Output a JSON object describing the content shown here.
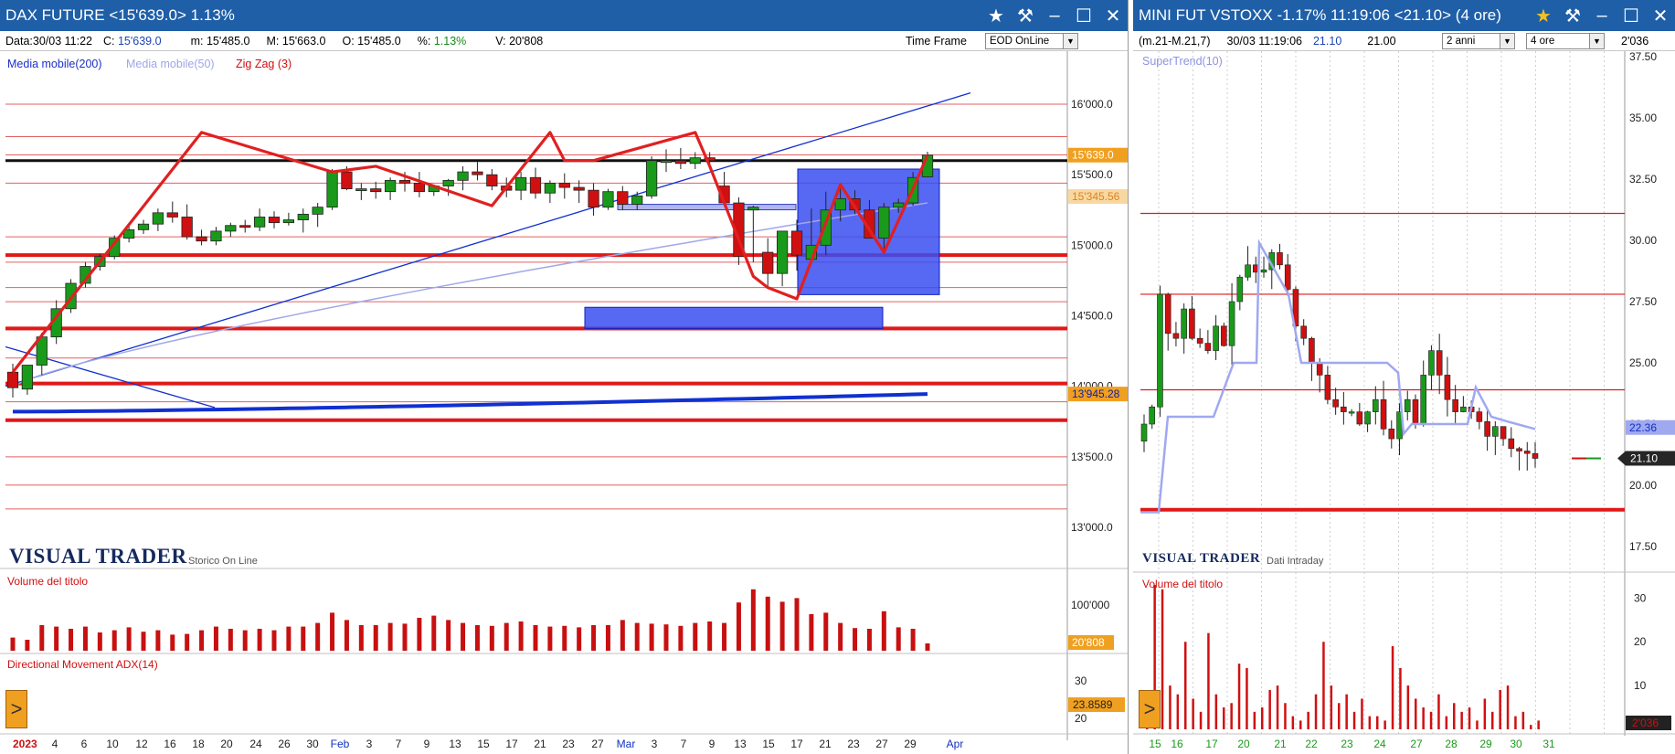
{
  "left": {
    "title": "DAX FUTURE <15'639.0> 1.13%",
    "info": {
      "data_label": "Data:",
      "data_value": "30/03 11:22",
      "close_label": "C:",
      "close_value": "15'639.0",
      "min_label": "m:",
      "min_value": "15'485.0",
      "max_label": "M:",
      "max_value": "15'663.0",
      "open_label": "O:",
      "open_value": "15'485.0",
      "pct_label": "%:",
      "pct_value": "1.13%",
      "vol_label": "V:",
      "vol_value": "20'808",
      "timeframe_label": "Time Frame",
      "timeframe_value": "EOD OnLine"
    },
    "legend": {
      "ma200": "Media mobile(200)",
      "ma50": "Media mobile(50)",
      "zigzag": "Zig Zag (3)"
    },
    "price_labels": [
      "16'000.0",
      "15'500.0",
      "15'000.0",
      "14'500.0",
      "14'000.0",
      "13'500.0",
      "13'000.0"
    ],
    "price_boxes": {
      "last": "15'639.0",
      "level": "15'345.56",
      "ma": "13'945.28"
    },
    "brand": "VISUAL TRADER",
    "brand_sub": "Storico On Line",
    "volume_title": "Volume del titolo",
    "volume_axis_label": "100'000",
    "volume_box": "20'808",
    "adx_title": "Directional Movement ADX(14)",
    "adx_labels": [
      "30",
      "20"
    ],
    "adx_box": "23.8589",
    "x_labels": [
      "2023",
      "4",
      "6",
      "10",
      "12",
      "16",
      "18",
      "20",
      "24",
      "26",
      "30",
      "Feb",
      "3",
      "7",
      "9",
      "13",
      "15",
      "17",
      "21",
      "23",
      "27",
      "Mar",
      "3",
      "7",
      "9",
      "13",
      "15",
      "17",
      "21",
      "23",
      "27",
      "29",
      "Apr"
    ],
    "colors": {
      "up": "#1a9a1a",
      "down": "#d01010",
      "ma200": "#1030d0",
      "ma50": "#a0a8e8",
      "zigzag": "#e02020",
      "box": "#3a4ef0"
    }
  },
  "right": {
    "title": "MINI FUT VSTOXX -1.17% 11:19:06 <21.10> (4 ore)",
    "info": {
      "range": "(m.21-M.21,7)",
      "datetime": "30/03 11:19:06",
      "v1": "21.10",
      "v2": "21.00",
      "period": "2 anni",
      "interval": "4 ore",
      "code": "2'036"
    },
    "legend": "SuperTrend(10)",
    "price_labels": [
      "37.50",
      "35.00",
      "32.50",
      "30.00",
      "27.50",
      "25.00",
      "22.50",
      "20.00",
      "17.50"
    ],
    "price_boxes": {
      "st": "22.36",
      "last": "21.10"
    },
    "brand": "VISUAL TRADER",
    "brand_sub": "Dati Intraday",
    "volume_title": "Volume del titolo",
    "volume_labels": [
      "30",
      "20",
      "10"
    ],
    "volume_box": "2'036",
    "x_labels": [
      "15",
      "16",
      "17",
      "20",
      "21",
      "22",
      "23",
      "24",
      "27",
      "28",
      "29",
      "30",
      "31"
    ]
  },
  "chart_data": [
    {
      "type": "candlestick",
      "title": "DAX FUTURE",
      "ylim": [
        12950,
        16150
      ],
      "x": [
        "2023-01-02",
        "2023-01-03",
        "2023-01-04",
        "2023-01-05",
        "2023-01-06",
        "2023-01-09",
        "2023-01-10",
        "2023-01-11",
        "2023-01-12",
        "2023-01-13",
        "2023-01-16",
        "2023-01-17",
        "2023-01-18",
        "2023-01-19",
        "2023-01-20",
        "2023-01-23",
        "2023-01-24",
        "2023-01-25",
        "2023-01-26",
        "2023-01-27",
        "2023-01-30",
        "2023-01-31",
        "2023-02-01",
        "2023-02-02",
        "2023-02-03",
        "2023-02-06",
        "2023-02-07",
        "2023-02-08",
        "2023-02-09",
        "2023-02-10",
        "2023-02-13",
        "2023-02-14",
        "2023-02-15",
        "2023-02-16",
        "2023-02-17",
        "2023-02-20",
        "2023-02-21",
        "2023-02-22",
        "2023-02-23",
        "2023-02-24",
        "2023-02-27",
        "2023-02-28",
        "2023-03-01",
        "2023-03-02",
        "2023-03-03",
        "2023-03-06",
        "2023-03-07",
        "2023-03-08",
        "2023-03-09",
        "2023-03-10",
        "2023-03-13",
        "2023-03-14",
        "2023-03-15",
        "2023-03-16",
        "2023-03-17",
        "2023-03-20",
        "2023-03-21",
        "2023-03-22",
        "2023-03-23",
        "2023-03-24",
        "2023-03-27",
        "2023-03-28",
        "2023-03-29",
        "2023-03-30"
      ],
      "open": [
        14100,
        13980,
        14150,
        14350,
        14550,
        14730,
        14850,
        14920,
        15050,
        15110,
        15150,
        15230,
        15200,
        15060,
        15030,
        15100,
        15140,
        15130,
        15200,
        15160,
        15180,
        15220,
        15270,
        15520,
        15400,
        15400,
        15380,
        15460,
        15440,
        15380,
        15420,
        15460,
        15520,
        15500,
        15420,
        15390,
        15480,
        15370,
        15440,
        15410,
        15390,
        15270,
        15380,
        15290,
        15350,
        15600,
        15600,
        15580,
        15620,
        15420,
        15300,
        15250,
        14950,
        14800,
        15100,
        14900,
        15000,
        15250,
        15330,
        15250,
        15050,
        15270,
        15300,
        15485
      ],
      "high": [
        14160,
        14100,
        14380,
        14610,
        14760,
        14880,
        14940,
        15070,
        15140,
        15180,
        15260,
        15310,
        15290,
        15110,
        15130,
        15160,
        15180,
        15260,
        15240,
        15230,
        15260,
        15300,
        15540,
        15560,
        15440,
        15450,
        15480,
        15520,
        15520,
        15430,
        15470,
        15560,
        15590,
        15540,
        15480,
        15520,
        15550,
        15460,
        15510,
        15460,
        15440,
        15400,
        15420,
        15380,
        15630,
        15680,
        15690,
        15660,
        15660,
        15520,
        15340,
        15280,
        15050,
        15100,
        15180,
        15260,
        15380,
        15410,
        15390,
        15320,
        15300,
        15330,
        15520,
        15663
      ],
      "low": [
        13920,
        13940,
        14080,
        14300,
        14520,
        14700,
        14820,
        14900,
        15020,
        15080,
        15100,
        15160,
        15040,
        15000,
        15000,
        15060,
        15090,
        15100,
        15120,
        15140,
        15090,
        15130,
        15250,
        15390,
        15320,
        15330,
        15320,
        15380,
        15340,
        15350,
        15350,
        15390,
        15460,
        15390,
        15340,
        15320,
        15330,
        15300,
        15330,
        15300,
        15210,
        15250,
        15250,
        15250,
        15330,
        15520,
        15540,
        15540,
        15580,
        15280,
        14860,
        14880,
        14700,
        14710,
        14820,
        14880,
        14930,
        15170,
        15220,
        15090,
        14970,
        15230,
        15280,
        15485
      ],
      "close": [
        13990,
        14150,
        14350,
        14550,
        14730,
        14850,
        14920,
        15050,
        15110,
        15150,
        15230,
        15200,
        15060,
        15030,
        15100,
        15140,
        15130,
        15200,
        15160,
        15180,
        15220,
        15270,
        15520,
        15400,
        15400,
        15380,
        15460,
        15440,
        15380,
        15420,
        15460,
        15520,
        15500,
        15420,
        15390,
        15480,
        15370,
        15440,
        15410,
        15390,
        15270,
        15380,
        15290,
        15350,
        15600,
        15600,
        15580,
        15620,
        15600,
        15300,
        14920,
        15270,
        14800,
        15100,
        14930,
        15000,
        15250,
        15330,
        15250,
        15050,
        15270,
        15300,
        15480,
        15639
      ],
      "ma200_end": 13945.28,
      "ma200_start": 13820
    },
    {
      "type": "bar",
      "title": "Volume del titolo",
      "values": [
        18,
        15,
        35,
        33,
        30,
        33,
        25,
        28,
        32,
        26,
        28,
        22,
        23,
        28,
        33,
        30,
        28,
        30,
        28,
        33,
        33,
        38,
        52,
        42,
        35,
        35,
        38,
        37,
        45,
        48,
        42,
        38,
        35,
        34,
        38,
        40,
        35,
        33,
        34,
        32,
        35,
        35,
        42,
        38,
        37,
        36,
        34,
        38,
        40,
        38,
        66,
        84,
        74,
        67,
        72,
        50,
        52,
        38,
        31,
        30,
        54,
        32,
        30,
        10
      ],
      "ylim": [
        0,
        110000
      ]
    },
    {
      "type": "bar",
      "title": "Volume del titolo (VSTOXX)",
      "values": [
        3,
        33,
        32,
        10,
        8,
        20,
        7,
        4,
        22,
        8,
        5,
        6,
        15,
        14,
        4,
        5,
        9,
        10,
        6,
        3,
        2,
        4,
        8,
        20,
        10,
        6,
        8,
        4,
        7,
        3,
        3,
        2,
        19,
        14,
        10,
        7,
        5,
        4,
        8,
        3,
        6,
        4,
        5,
        2,
        7,
        4,
        9,
        10,
        3,
        4,
        1,
        2
      ],
      "ylim": [
        0,
        33
      ]
    }
  ]
}
